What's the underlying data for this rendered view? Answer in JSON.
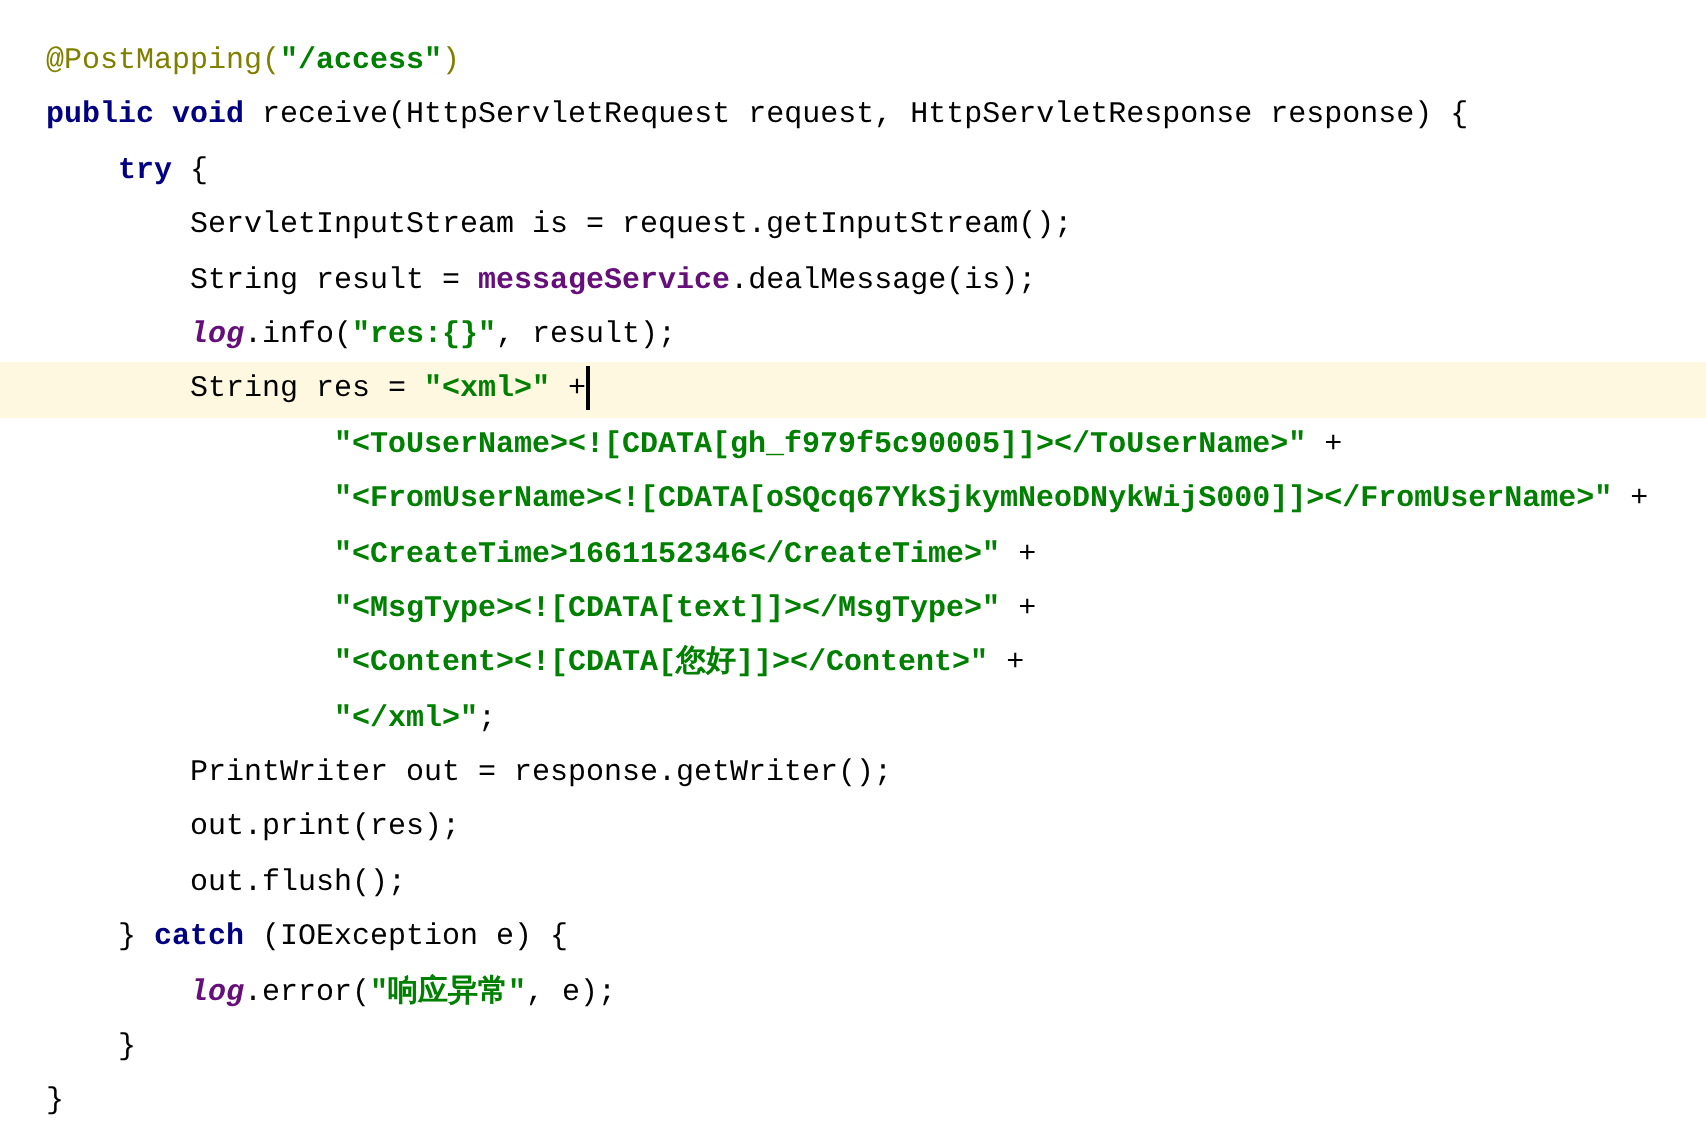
{
  "editor": {
    "lines": [
      {
        "current": false,
        "tokens": [
          {
            "kind": "annotation",
            "text": "@PostMapping("
          },
          {
            "kind": "string",
            "text": "\"/access\""
          },
          {
            "kind": "annotation",
            "text": ")"
          }
        ]
      },
      {
        "current": false,
        "tokens": [
          {
            "kind": "keyword",
            "text": "public void"
          },
          {
            "kind": "plain",
            "text": " receive(HttpServletRequest request, HttpServletResponse response) {"
          }
        ],
        "children": [
          {
            "current": false,
            "tokens": [
              {
                "kind": "keyword",
                "text": "try"
              },
              {
                "kind": "plain",
                "text": " {"
              }
            ],
            "children": [
              {
                "current": false,
                "tokens": [
                  {
                    "kind": "plain",
                    "text": "ServletInputStream is = request.getInputStream();"
                  }
                ]
              },
              {
                "current": false,
                "tokens": [
                  {
                    "kind": "plain",
                    "text": "String result = "
                  },
                  {
                    "kind": "field",
                    "text": "messageService"
                  },
                  {
                    "kind": "plain",
                    "text": ".dealMessage(is);"
                  }
                ]
              },
              {
                "current": false,
                "tokens": [
                  {
                    "kind": "static",
                    "text": "log"
                  },
                  {
                    "kind": "plain",
                    "text": ".info("
                  },
                  {
                    "kind": "string",
                    "text": "\"res:{}\""
                  },
                  {
                    "kind": "plain",
                    "text": ", result);"
                  }
                ]
              },
              {
                "current": true,
                "tokens": [
                  {
                    "kind": "plain",
                    "text": "String res = "
                  },
                  {
                    "kind": "string",
                    "text": "\"<xml>\""
                  },
                  {
                    "kind": "plain",
                    "text": " +"
                  }
                ],
                "children": [
                  {
                    "kind": "continuation",
                    "current": false,
                    "tokens": [
                      {
                        "kind": "string",
                        "text": "\"<ToUserName><![CDATA[gh_f979f5c90005]]></ToUserName>\""
                      },
                      {
                        "kind": "plain",
                        "text": " +"
                      }
                    ]
                  },
                  {
                    "kind": "continuation",
                    "current": false,
                    "tokens": [
                      {
                        "kind": "string",
                        "text": "\"<FromUserName><![CDATA[oSQcq67YkSjkymNeoDNykWijS000]]></FromUserName>\""
                      },
                      {
                        "kind": "plain",
                        "text": " +"
                      }
                    ]
                  },
                  {
                    "kind": "continuation",
                    "current": false,
                    "tokens": [
                      {
                        "kind": "string",
                        "text": "\"<CreateTime>1661152346</CreateTime>\""
                      },
                      {
                        "kind": "plain",
                        "text": " +"
                      }
                    ]
                  },
                  {
                    "kind": "continuation",
                    "current": false,
                    "tokens": [
                      {
                        "kind": "string",
                        "text": "\"<MsgType><![CDATA[text]]></MsgType>\""
                      },
                      {
                        "kind": "plain",
                        "text": " +"
                      }
                    ]
                  },
                  {
                    "kind": "continuation",
                    "current": false,
                    "tokens": [
                      {
                        "kind": "string",
                        "text": "\"<Content><![CDATA[您好]]></Content>\""
                      },
                      {
                        "kind": "plain",
                        "text": " +"
                      }
                    ]
                  },
                  {
                    "kind": "continuation",
                    "current": false,
                    "tokens": [
                      {
                        "kind": "string",
                        "text": "\"</xml>\""
                      },
                      {
                        "kind": "plain",
                        "text": ";"
                      }
                    ]
                  }
                ]
              },
              {
                "current": false,
                "tokens": [
                  {
                    "kind": "plain",
                    "text": "PrintWriter out = response.getWriter();"
                  }
                ]
              },
              {
                "current": false,
                "tokens": [
                  {
                    "kind": "plain",
                    "text": "out.print(res);"
                  }
                ]
              },
              {
                "current": false,
                "tokens": [
                  {
                    "kind": "plain",
                    "text": "out.flush();"
                  }
                ]
              }
            ]
          },
          {
            "current": false,
            "tokens": [
              {
                "kind": "plain",
                "text": "} "
              },
              {
                "kind": "keyword",
                "text": "catch"
              },
              {
                "kind": "plain",
                "text": " (IOException e) {"
              }
            ],
            "children": [
              {
                "current": false,
                "tokens": [
                  {
                    "kind": "static",
                    "text": "log"
                  },
                  {
                    "kind": "plain",
                    "text": ".error("
                  },
                  {
                    "kind": "string",
                    "text": "\"响应异常\""
                  },
                  {
                    "kind": "plain",
                    "text": ", e);"
                  }
                ]
              }
            ]
          },
          {
            "current": false,
            "tokens": [
              {
                "kind": "plain",
                "text": "}"
              }
            ]
          }
        ]
      },
      {
        "current": false,
        "tokens": [
          {
            "kind": "plain",
            "text": "}"
          }
        ]
      }
    ]
  }
}
